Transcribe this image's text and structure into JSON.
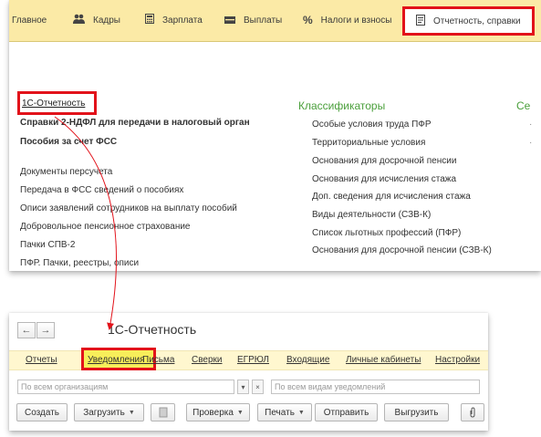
{
  "section_menu": {
    "items": [
      {
        "label": "Главное",
        "icon": ""
      },
      {
        "label": "Кадры",
        "icon": "people-icon"
      },
      {
        "label": "Зарплата",
        "icon": "calculator-icon"
      },
      {
        "label": "Выплаты",
        "icon": "cash-icon"
      },
      {
        "label": "Налоги и взносы",
        "icon": "percent-icon"
      },
      {
        "label": "Отчетность, справки",
        "icon": "report-icon",
        "active": true
      }
    ]
  },
  "reports_panel": {
    "left_links": {
      "highlighted": "1С-Отчетность",
      "bold": [
        "Справки 2-НДФЛ для передачи в налоговый орган",
        "Пособия за счет ФСС"
      ],
      "regular": [
        "Документы персучета",
        "Передача в ФСС сведений о пособиях",
        "Описи заявлений сотрудников на выплату пособий",
        "Добровольное пенсионное страхование",
        "Пачки СПВ-2",
        "ПФР. Пачки, реестры, описи"
      ]
    },
    "classifiers": {
      "title": "Классификаторы",
      "next_title_partial": "Се",
      "items": [
        "Особые условия труда ПФР",
        "Территориальные условия",
        "Основания для досрочной пенсии",
        "Основания для исчисления стажа",
        "Доп. сведения для исчисления стажа",
        "Виды деятельности (СЗВ-К)",
        "Список льготных профессий (ПФР)",
        "Основания для досрочной пенсии (СЗВ-К)"
      ]
    }
  },
  "one_c_reporting": {
    "title": "1С-Отчетность",
    "nav": {
      "back": "←",
      "forward": "→"
    },
    "tabs": [
      "Отчеты",
      "Уведомления",
      "Письма",
      "Сверки",
      "ЕГРЮЛ",
      "Входящие",
      "Личные кабинеты",
      "Настройки"
    ],
    "highlighted_tab": "Уведомления",
    "filters": {
      "organization_placeholder": "По всем организациям",
      "notification_type_placeholder": "По всем видам уведомлений"
    },
    "buttons": {
      "create": "Создать",
      "upload": "Загрузить",
      "check": "Проверка",
      "print": "Печать",
      "send": "Отправить",
      "download": "Выгрузить"
    }
  },
  "colors": {
    "menu_bg": "#fbeaa6",
    "highlight_red": "#e2121a",
    "classifier_green": "#4a9f3b",
    "tab_highlight_yellow": "#f7ee5a"
  }
}
